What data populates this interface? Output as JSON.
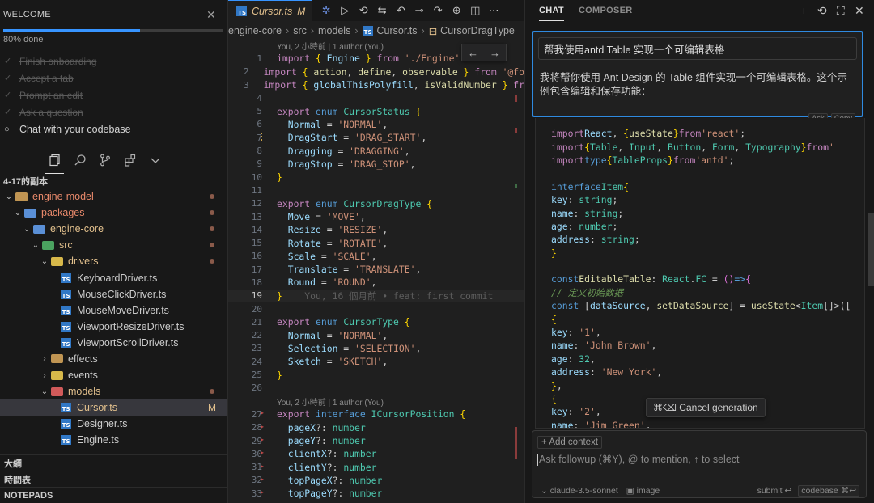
{
  "sidebar": {
    "welcome_title": "WELCOME",
    "progress": 0.8,
    "progress_text": "80% done",
    "checklist": [
      {
        "label": "Finish onboarding",
        "done": true
      },
      {
        "label": "Accept a tab",
        "done": true
      },
      {
        "label": "Prompt an edit",
        "done": true
      },
      {
        "label": "Ask a question",
        "done": true
      },
      {
        "label": "Chat with your codebase",
        "done": false
      }
    ],
    "explorer_title": "4-17的副本",
    "tree": [
      {
        "indent": 0,
        "chev": "⌄",
        "icon": "folder",
        "color": "",
        "label": "engine-model",
        "style": "orange",
        "dot": true
      },
      {
        "indent": 1,
        "chev": "⌄",
        "icon": "folder",
        "color": "blue",
        "label": "packages",
        "style": "orange",
        "dot": true
      },
      {
        "indent": 2,
        "chev": "⌄",
        "icon": "folder",
        "color": "blue",
        "label": "engine-core",
        "style": "mod",
        "dot": true
      },
      {
        "indent": 3,
        "chev": "⌄",
        "icon": "folder",
        "color": "green",
        "label": "src",
        "style": "mod",
        "dot": true
      },
      {
        "indent": 4,
        "chev": "⌄",
        "icon": "folder",
        "color": "yellow",
        "label": "drivers",
        "style": "mod",
        "dot": true
      },
      {
        "indent": 5,
        "chev": "",
        "icon": "ts",
        "color": "",
        "label": "KeyboardDriver.ts",
        "style": "",
        "dot": false
      },
      {
        "indent": 5,
        "chev": "",
        "icon": "ts",
        "color": "",
        "label": "MouseClickDriver.ts",
        "style": "",
        "dot": false
      },
      {
        "indent": 5,
        "chev": "",
        "icon": "ts",
        "color": "",
        "label": "MouseMoveDriver.ts",
        "style": "",
        "dot": false
      },
      {
        "indent": 5,
        "chev": "",
        "icon": "ts",
        "color": "",
        "label": "ViewportResizeDriver.ts",
        "style": "",
        "dot": false
      },
      {
        "indent": 5,
        "chev": "",
        "icon": "ts",
        "color": "",
        "label": "ViewportScrollDriver.ts",
        "style": "",
        "dot": false
      },
      {
        "indent": 4,
        "chev": "›",
        "icon": "folder",
        "color": "",
        "label": "effects",
        "style": "",
        "dot": false
      },
      {
        "indent": 4,
        "chev": "›",
        "icon": "folder",
        "color": "yellow",
        "label": "events",
        "style": "",
        "dot": false
      },
      {
        "indent": 4,
        "chev": "⌄",
        "icon": "folder",
        "color": "red",
        "label": "models",
        "style": "mod",
        "dot": true
      },
      {
        "indent": 5,
        "chev": "",
        "icon": "ts",
        "color": "",
        "label": "Cursor.ts",
        "style": "mod",
        "dot": false,
        "badge": "M",
        "selected": true
      },
      {
        "indent": 5,
        "chev": "",
        "icon": "ts",
        "color": "",
        "label": "Designer.ts",
        "style": "",
        "dot": false
      },
      {
        "indent": 5,
        "chev": "",
        "icon": "ts",
        "color": "",
        "label": "Engine.ts",
        "style": "",
        "dot": false
      }
    ],
    "bottom_sections": [
      "大綱",
      "時間表",
      "NOTEPADS"
    ]
  },
  "editor": {
    "tab_label": "Cursor.ts",
    "tab_status": "M",
    "breadcrumb": [
      "engine-core",
      "src",
      "models",
      "Cursor.ts",
      "CursorDragType"
    ],
    "blame_top": "You, 2 小時前 | 1 author (You)",
    "blame_mid": "You, 2 小時前 | 1 author (You)",
    "inline_blame": "You, 16 個月前 • feat: first commit",
    "current_line": 19,
    "lines": [
      {
        "n": 1,
        "html": "<span class='kw'>import</span> <span class='br1'>{</span> <span class='pr'>Engine</span> <span class='br1'>}</span> <span class='kw'>from</span> <span class='str'>'./Engine'</span>"
      },
      {
        "n": 2,
        "html": "<span class='kw'>import</span> <span class='br1'>{</span> <span class='fn'>action</span>, <span class='fn'>define</span>, <span class='fn'>observable</span> <span class='br1'>}</span> <span class='kw'>from</span> <span class='str'>'@fo</span>"
      },
      {
        "n": 3,
        "html": "<span class='kw'>import</span> <span class='br1'>{</span> <span class='pr'>globalThisPolyfill</span>, <span class='fn'>isValidNumber</span> <span class='br1'>}</span> <span class='kw'>fr</span>"
      },
      {
        "n": 4,
        "html": ""
      },
      {
        "n": 5,
        "html": "<span class='kw'>export</span> <span class='kw2'>enum</span> <span class='ty'>CursorStatus</span> <span class='br1'>{</span>"
      },
      {
        "n": 6,
        "html": "  <span class='pr'>Normal</span> = <span class='str'>'NORMAL'</span>,"
      },
      {
        "n": 7,
        "html": "  <span class='pr'>DragStart</span> = <span class='str'>'DRAG_START'</span>,"
      },
      {
        "n": 8,
        "html": "  <span class='pr'>Dragging</span> = <span class='str'>'DRAGGING'</span>,"
      },
      {
        "n": 9,
        "html": "  <span class='pr'>DragStop</span> = <span class='str'>'DRAG_STOP'</span>,"
      },
      {
        "n": 10,
        "html": "<span class='br1'>}</span>"
      },
      {
        "n": 11,
        "html": ""
      },
      {
        "n": 12,
        "html": "<span class='kw'>export</span> <span class='kw2'>enum</span> <span class='ty'>CursorDragType</span> <span class='br1'>{</span>"
      },
      {
        "n": 13,
        "html": "  <span class='pr'>Move</span> = <span class='str'>'MOVE'</span>,"
      },
      {
        "n": 14,
        "html": "  <span class='pr'>Resize</span> = <span class='str'>'RESIZE'</span>,"
      },
      {
        "n": 15,
        "html": "  <span class='pr'>Rotate</span> = <span class='str'>'ROTATE'</span>,"
      },
      {
        "n": 16,
        "html": "  <span class='pr'>Scale</span> = <span class='str'>'SCALE'</span>,"
      },
      {
        "n": 17,
        "html": "  <span class='pr'>Translate</span> = <span class='str'>'TRANSLATE'</span>,"
      },
      {
        "n": 18,
        "html": "  <span class='pr'>Round</span> = <span class='str'>'ROUND'</span>,"
      },
      {
        "n": 19,
        "html": "<span class='br1'>}</span>    <span class='ghost'>You, 16 個月前 • feat: first commit</span>"
      },
      {
        "n": 20,
        "html": ""
      },
      {
        "n": 21,
        "html": "<span class='kw'>export</span> <span class='kw2'>enum</span> <span class='ty'>CursorType</span> <span class='br1'>{</span>"
      },
      {
        "n": 22,
        "html": "  <span class='pr'>Normal</span> = <span class='str'>'NORMAL'</span>,"
      },
      {
        "n": 23,
        "html": "  <span class='pr'>Selection</span> = <span class='str'>'SELECTION'</span>,"
      },
      {
        "n": 24,
        "html": "  <span class='pr'>Sketch</span> = <span class='str'>'SKETCH'</span>,"
      },
      {
        "n": 25,
        "html": "<span class='br1'>}</span>"
      },
      {
        "n": 26,
        "html": ""
      },
      {
        "n": 27,
        "html": "<span class='kw'>export</span> <span class='kw2'>interface</span> <span class='ty'>ICursorPosition</span> <span class='br1'>{</span>"
      },
      {
        "n": 28,
        "html": "  <span class='pr'>pageX</span>?: <span class='ty'>number</span>"
      },
      {
        "n": 29,
        "html": "  <span class='pr'>pageY</span>?: <span class='ty'>number</span>"
      },
      {
        "n": 30,
        "html": "  <span class='pr'>clientX</span>?: <span class='ty'>number</span>"
      },
      {
        "n": 31,
        "html": "  <span class='pr'>clientY</span>?: <span class='ty'>number</span>"
      },
      {
        "n": 32,
        "html": "  <span class='pr'>topPageX</span>?: <span class='ty'>number</span>"
      },
      {
        "n": 33,
        "html": "  <span class='pr'>topPageY</span>?: <span class='ty'>number</span>"
      }
    ]
  },
  "chat": {
    "tabs": [
      "CHAT",
      "COMPOSER"
    ],
    "user_message": "帮我使用antd Table 实现一个可编辑表格",
    "reply_intro": "我将帮你使用 Ant Design 的 Table 组件实现一个可编辑表格。这个示例包含编辑和保存功能：",
    "mini_buttons": [
      "Ask",
      "Copy"
    ],
    "code": [
      "<span class='kw'>import</span> <span class='pr'>React</span>, <span class='br1'>{</span> <span class='fn'>useState</span> <span class='br1'>}</span> <span class='kw'>from</span> <span class='str'>'react'</span>;",
      "<span class='kw'>import</span> <span class='br1'>{</span> <span class='ty'>Table</span>, <span class='ty'>Input</span>, <span class='ty'>Button</span>, <span class='ty'>Form</span>, <span class='ty'>Typography</span> <span class='br1'>}</span> <span class='kw'>from</span> <span class='str'>'</span>",
      "<span class='kw'>import</span> <span class='kw2'>type</span> <span class='br1'>{</span> <span class='ty'>TableProps</span> <span class='br1'>}</span> <span class='kw'>from</span> <span class='str'>'antd'</span>;",
      "",
      "<span class='kw2'>interface</span> <span class='ty'>Item</span> <span class='br1'>{</span>",
      "  <span class='pr'>key</span>: <span class='ty'>string</span>;",
      "  <span class='pr'>name</span>: <span class='ty'>string</span>;",
      "  <span class='pr'>age</span>: <span class='ty'>number</span>;",
      "  <span class='pr'>address</span>: <span class='ty'>string</span>;",
      "<span class='br1'>}</span>",
      "",
      "<span class='kw2'>const</span> <span class='fn'>EditableTable</span>: <span class='ty'>React</span>.<span class='ty'>FC</span> = <span class='br2'>()</span> <span class='kw2'>=&gt;</span> <span class='br2'>{</span>",
      "  <span class='cmt'>// 定义初始数据</span>",
      "  <span class='kw2'>const</span> [<span class='pr'>dataSource</span>, <span class='fn'>setDataSource</span>] = <span class='fn'>useState</span>&lt;<span class='ty'>Item</span>[]&gt;([",
      "    <span class='br1'>{</span>",
      "      <span class='pr'>key</span>: <span class='str'>'1'</span>,",
      "      <span class='pr'>name</span>: <span class='str'>'John Brown'</span>,",
      "      <span class='pr'>age</span>: <span class='ty'>32</span>,",
      "      <span class='pr'>address</span>: <span class='str'>'New York'</span>,",
      "    <span class='br1'>}</span>,",
      "    <span class='br1'>{</span>",
      "      <span class='pr'>key</span>: <span class='str'>'2'</span>,",
      "      <span class='pr'>name</span>: <span class='str'>'Jim Green'</span>,"
    ],
    "cancel_tooltip": "⌘⌫ Cancel generation",
    "add_context": "+ Add context",
    "input_placeholder": "Ask followup (⌘Y), @ to mention, ↑ to select",
    "model": "⌄ claude-3.5-sonnet",
    "image_label": "▣ image",
    "submit_label": "submit ↩",
    "codebase_label": "codebase ⌘↩"
  }
}
